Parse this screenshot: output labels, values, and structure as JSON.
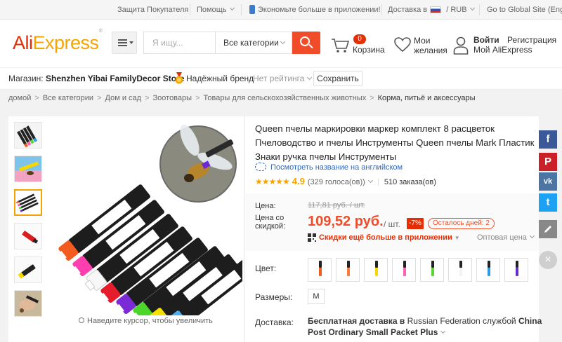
{
  "topbar": {
    "buyer_protection": "Защита Покупателя",
    "help": "Помощь",
    "app_promo": "Экономьте больше в приложении!",
    "ship_to": "Доставка в",
    "currency": "RUB",
    "global_site": "Go to Global Site (English)"
  },
  "header": {
    "logo_part1": "Ali",
    "logo_part2": "Express",
    "logo_tm": "®",
    "search_placeholder": "Я ищу...",
    "category_select": "Все категории",
    "cart_count": "0",
    "cart_label": "Корзина",
    "wishlist_line1": "Мои",
    "wishlist_line2": "желания",
    "login": "Войти",
    "register": "Регистрация",
    "my_account": "Мой AliExpress"
  },
  "store": {
    "label": "Магазин:",
    "name": "Shenzhen Yibai FamilyDecor Store",
    "brand": "Надёжный бренд",
    "rating": "Нет рейтинга",
    "save": "Сохранить"
  },
  "breadcrumb": [
    "домой",
    "Все категории",
    "Дом и сад",
    "Зоотовары",
    "Товары для сельскохозяйственных животных",
    "Корма, питьё и аксессуары"
  ],
  "gallery": {
    "zoom_hint": "Наведите курсор, чтобы увеличить"
  },
  "product": {
    "title": "Queen пчелы маркировки маркер комплект 8 расцветок Пчеловодство и пчелы Инструменты Queen пчелы Mark Пластик Знаки ручка пчелы Инструменты",
    "translate_link": "Посмотреть название на английском",
    "stars": "★★★★★",
    "rating_score": "4.9",
    "votes": "(329 голоса(ов))",
    "orders": "510 заказа(ов)"
  },
  "pricing": {
    "price_label": "Цена:",
    "old_price": "117,81 руб. / шт.",
    "discount_label_line1": "Цена со",
    "discount_label_line2": "скидкой:",
    "new_price": "109,52 руб.",
    "per_unit": "/ шт.",
    "discount_pct": "-7%",
    "days_left": "Осталось дней: 2",
    "app_discount": "Скидки ещё больше в приложении",
    "wholesale": "Оптовая цена"
  },
  "options": {
    "color_label": "Цвет:",
    "swatch_colors": [
      "#f25c20",
      "#ff7b3a",
      "#f5d800",
      "#ff5fb8",
      "#56d62f",
      "#f2f2f2",
      "#2b9be8",
      "#6a2bd6"
    ],
    "size_label": "Размеры:",
    "size_value": "M",
    "shipping_label": "Доставка:",
    "shipping_text_1": "Бесплатная доставка в",
    "shipping_dest": "Russian Federation",
    "shipping_text_2": "службой",
    "shipping_text_3": "China Post Ordinary Small Packet Plus"
  },
  "social": {
    "facebook": "f",
    "pinterest": "P",
    "vk": "vk",
    "twitter": "t",
    "close": "×"
  }
}
